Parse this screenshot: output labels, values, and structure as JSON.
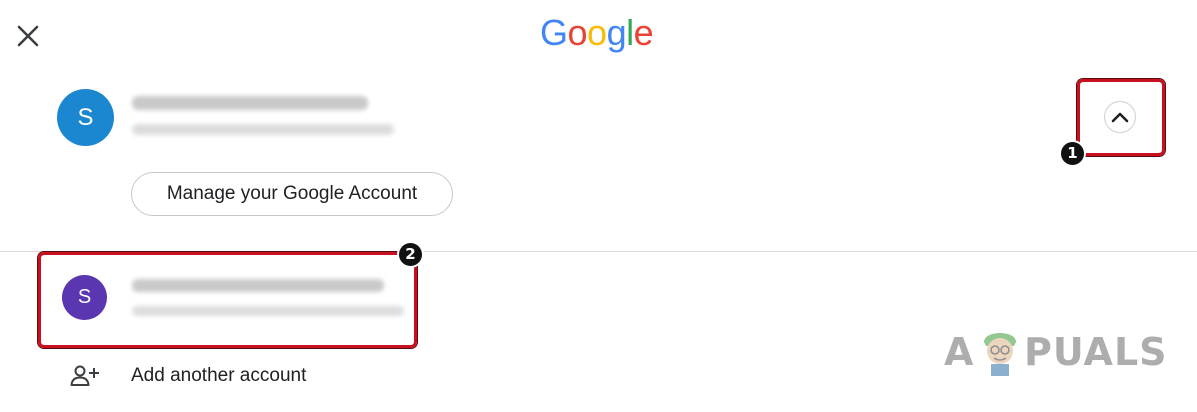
{
  "header": {
    "logo_text": "Google",
    "logo_letters": [
      {
        "char": "G",
        "color": "#4285F4"
      },
      {
        "char": "o",
        "color": "#EA4335"
      },
      {
        "char": "o",
        "color": "#FBBC05"
      },
      {
        "char": "g",
        "color": "#4285F4"
      },
      {
        "char": "l",
        "color": "#34A853"
      },
      {
        "char": "e",
        "color": "#EA4335"
      }
    ],
    "close_icon": "close-icon"
  },
  "primary_account": {
    "avatar_letter": "S",
    "avatar_color": "#1a87d0",
    "manage_button_label": "Manage your Google Account",
    "expand_icon": "chevron-up-icon"
  },
  "secondary_account": {
    "avatar_letter": "S",
    "avatar_color": "#5a36b0"
  },
  "add_account": {
    "label": "Add another account",
    "icon": "add-person-icon"
  },
  "annotations": {
    "step_1": "1",
    "step_2": "2",
    "highlight_color": "#c8101e"
  },
  "watermark": {
    "left_text": "A",
    "right_text": "PUALS"
  }
}
